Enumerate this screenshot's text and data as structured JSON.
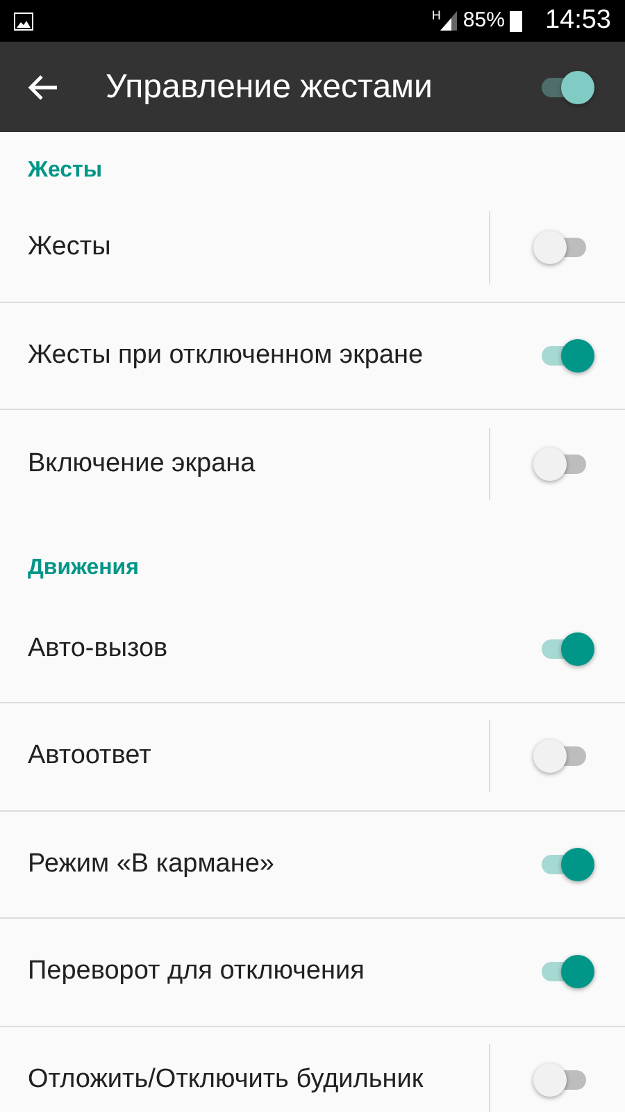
{
  "status_bar": {
    "network": "H",
    "battery": "85%",
    "time": "14:53"
  },
  "toolbar": {
    "title": "Управление жестами",
    "on": true
  },
  "sections": [
    {
      "title": "Жесты",
      "items": [
        {
          "label": "Жесты",
          "kind": "split",
          "on": false
        },
        {
          "label": "Жесты при отключенном экране",
          "kind": "switch",
          "on": true
        },
        {
          "label": "Включение экрана",
          "kind": "split",
          "on": false
        }
      ]
    },
    {
      "title": "Движения",
      "items": [
        {
          "label": "Авто-вызов",
          "kind": "switch",
          "on": true
        },
        {
          "label": "Автоответ",
          "kind": "split",
          "on": false
        },
        {
          "label": "Режим «В кармане»",
          "kind": "switch",
          "on": true
        },
        {
          "label": "Переворот для отключения",
          "kind": "switch",
          "on": true
        },
        {
          "label": "Отложить/Отключить будильник",
          "kind": "split",
          "on": false
        }
      ]
    }
  ]
}
